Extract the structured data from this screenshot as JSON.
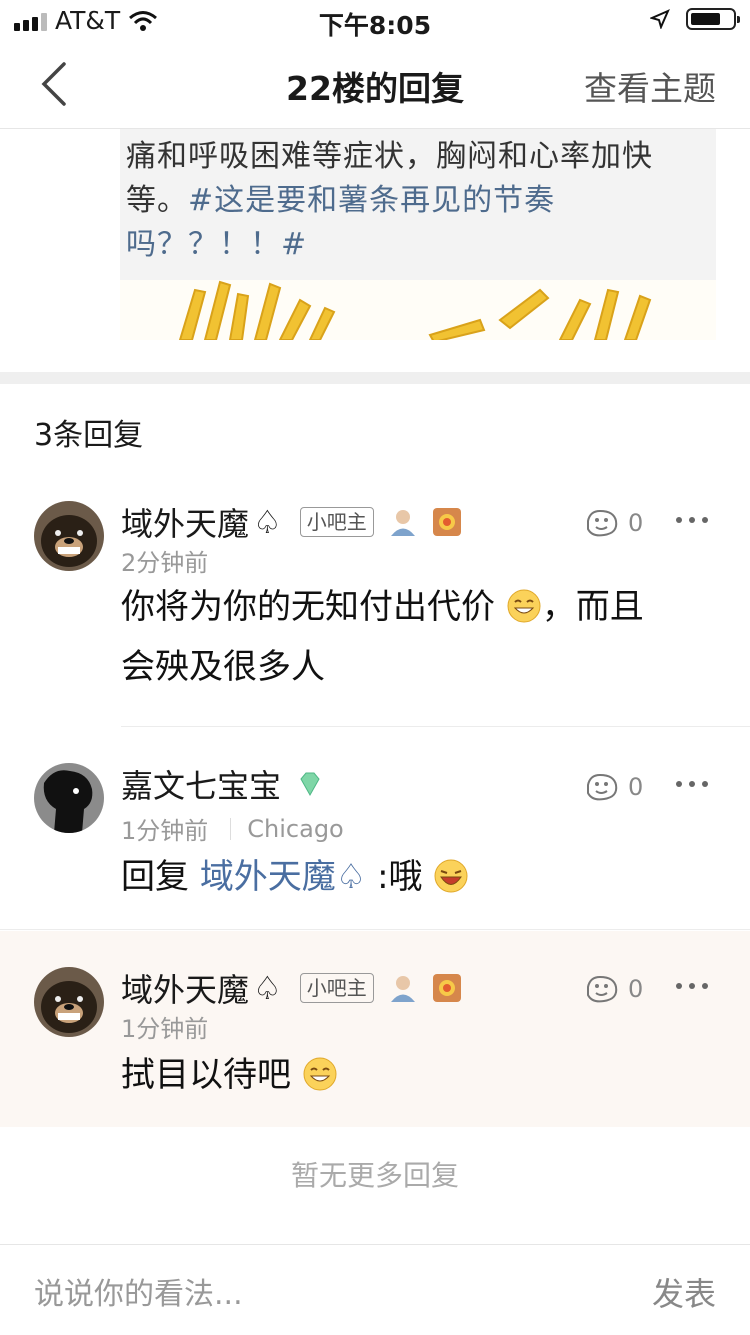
{
  "status": {
    "carrier": "AT&T",
    "time": "下午8:05"
  },
  "nav": {
    "title": "22楼的回复",
    "view_topic": "查看主题"
  },
  "preview": {
    "line1": "痛和呼吸困难等症状，胸闷和心率加快",
    "line2_prefix": "等。",
    "line2_tag": "#这是要和薯条再见的节奏",
    "line3": "吗？？！！#"
  },
  "section_title": "3条回复",
  "replies": [
    {
      "username": "域外天魔",
      "suit": "♤",
      "badge": "小吧主",
      "time": "2分钟前",
      "likes": "0",
      "content_a": "你将为你的无知付出代价",
      "content_b": "，而且",
      "content_c": "会殃及很多人"
    },
    {
      "username": "嘉文七宝宝",
      "time": "1分钟前",
      "location": "Chicago",
      "likes": "0",
      "content_prefix": "回复 ",
      "content_link": "域外天魔♤",
      "content_suffix": " :哦"
    },
    {
      "username": "域外天魔",
      "suit": "♤",
      "badge": "小吧主",
      "time": "1分钟前",
      "likes": "0",
      "content": "拭目以待吧"
    }
  ],
  "no_more": "暂无更多回复",
  "bottom": {
    "placeholder": "说说你的看法...",
    "send": "发表"
  }
}
